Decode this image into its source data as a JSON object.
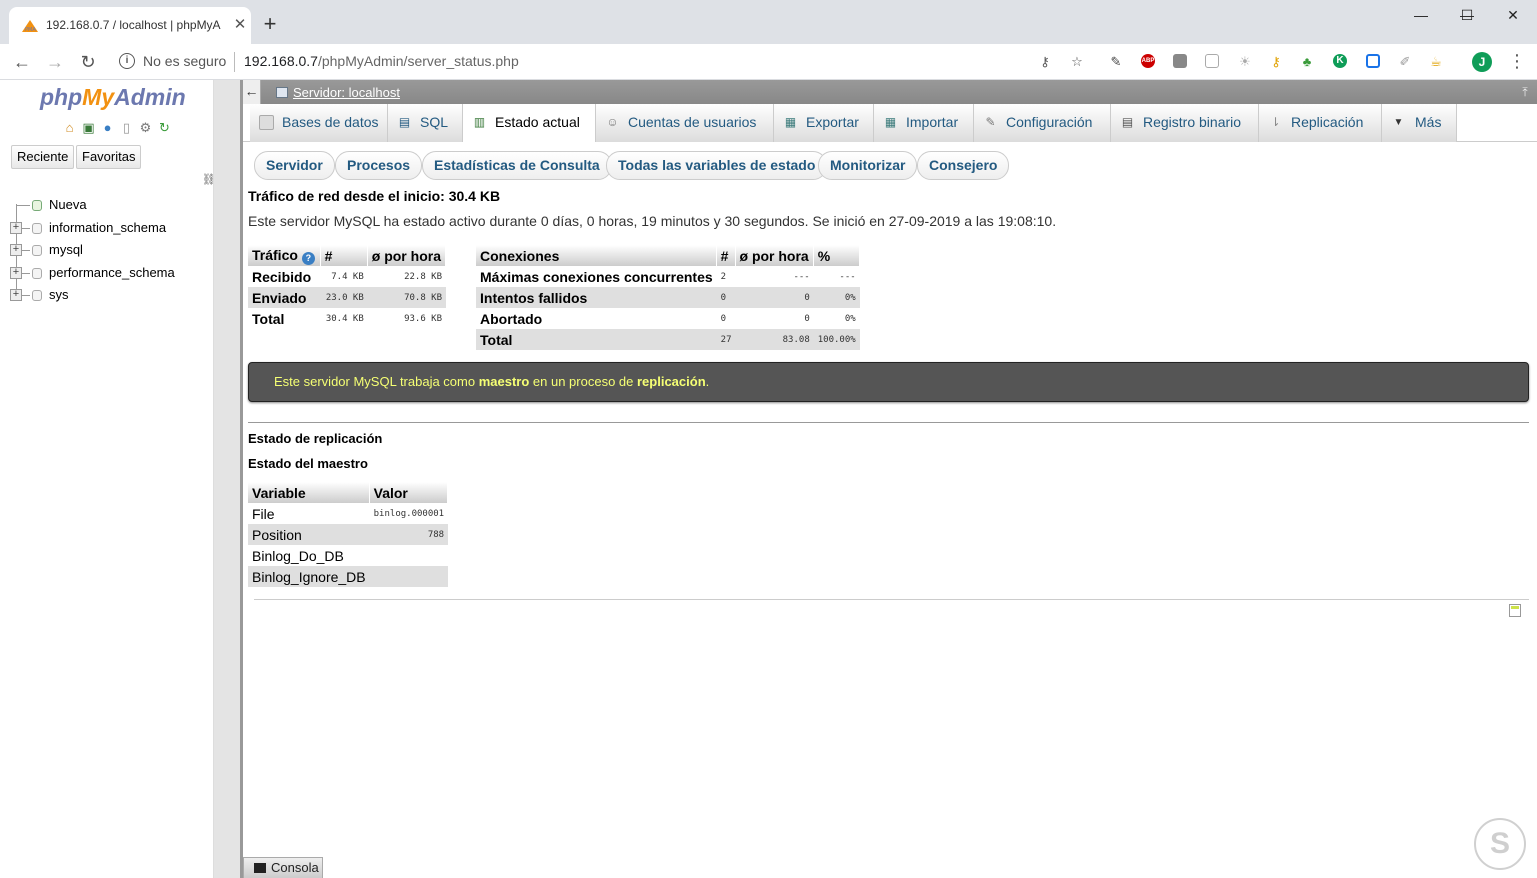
{
  "browser": {
    "tab_title": "192.168.0.7 / localhost | phpMyA",
    "tab_close": "✕",
    "new_tab": "+",
    "minimize": "—",
    "maximize": "☐",
    "close": "✕",
    "nav_back": "←",
    "nav_forward": "→",
    "reload": "↻",
    "security_text": "No es seguro",
    "url_host": "192.168.0.7",
    "url_path": "/phpMyAdmin/server_status.php",
    "avatar": "J",
    "menu": "⋮",
    "extensions": [
      "key-icon",
      "star-icon",
      "pen-icon",
      "adblock-icon",
      "box-icon",
      "copy-icon",
      "bulb-icon",
      "key-orange-icon",
      "plant-icon",
      "k-icon",
      "grid-icon",
      "pen2-icon",
      "teapot-icon"
    ],
    "abp_label": "ABP",
    "k_label": "K"
  },
  "navigation": {
    "logo_php": "php",
    "logo_my": "My",
    "logo_admin": "Admin",
    "recent_button": "Reciente",
    "favorites_button": "Favoritas",
    "tree": [
      {
        "label": "Nueva",
        "type": "new"
      },
      {
        "label": "information_schema",
        "type": "db"
      },
      {
        "label": "mysql",
        "type": "db"
      },
      {
        "label": "performance_schema",
        "type": "db"
      },
      {
        "label": "sys",
        "type": "db"
      }
    ]
  },
  "serverbar": {
    "label": "Servidor: localhost",
    "collapse": "←",
    "minimize": "⤒"
  },
  "main_tabs": [
    {
      "label": "Bases de datos",
      "active": false
    },
    {
      "label": "SQL",
      "active": false
    },
    {
      "label": "Estado actual",
      "active": true
    },
    {
      "label": "Cuentas de usuarios",
      "active": false
    },
    {
      "label": "Exportar",
      "active": false
    },
    {
      "label": "Importar",
      "active": false
    },
    {
      "label": "Configuración",
      "active": false
    },
    {
      "label": "Registro binario",
      "active": false
    },
    {
      "label": "Replicación",
      "active": false
    },
    {
      "label": "Más",
      "active": false
    }
  ],
  "sub_tabs": [
    {
      "label": "Servidor"
    },
    {
      "label": "Procesos"
    },
    {
      "label": "Estadísticas de Consulta"
    },
    {
      "label": "Todas las variables de estado"
    },
    {
      "label": "Monitorizar"
    },
    {
      "label": "Consejero"
    }
  ],
  "status": {
    "traffic_heading": "Tráfico de red desde el inicio: 30.4 KB",
    "uptime_text": "Este servidor MySQL ha estado activo durante 0 días, 0 horas, 19 minutos y 30 segundos. Se inició en 27-09-2019 a las 19:08:10."
  },
  "traffic_table": {
    "headers": [
      "Tráfico",
      "#",
      "ø por hora"
    ],
    "rows": [
      [
        "Recibido",
        "7.4 KB",
        "22.8 KB"
      ],
      [
        "Enviado",
        "23.0 KB",
        "70.8 KB"
      ],
      [
        "Total",
        "30.4 KB",
        "93.6 KB"
      ]
    ]
  },
  "connections_table": {
    "headers": [
      "Conexiones",
      "#",
      "ø por hora",
      "%"
    ],
    "rows": [
      [
        "Máximas conexiones concurrentes",
        "2",
        "---",
        "---"
      ],
      [
        "Intentos fallidos",
        "0",
        "0",
        "0%"
      ],
      [
        "Abortado",
        "0",
        "0",
        "0%"
      ],
      [
        "Total",
        "27",
        "83.08",
        "100.00%"
      ]
    ]
  },
  "replication_notice": {
    "part1": "Este servidor MySQL trabaja como ",
    "bold1": "maestro",
    "part2": " en un proceso de ",
    "bold2": "replicación",
    "part3": "."
  },
  "replication": {
    "heading": "Estado de replicación",
    "master_heading": "Estado del maestro",
    "headers": [
      "Variable",
      "Valor"
    ],
    "rows": [
      [
        "File",
        "binlog.000001"
      ],
      [
        "Position",
        "788"
      ],
      [
        "Binlog_Do_DB",
        ""
      ],
      [
        "Binlog_Ignore_DB",
        ""
      ]
    ]
  },
  "console": {
    "label": "Consola"
  },
  "watermark": "S",
  "colors": {
    "link": "#235a81",
    "notice_bg": "#555555",
    "notice_text": "#f5ff74",
    "logo_blue": "#6c78af",
    "logo_orange": "#f29111"
  }
}
